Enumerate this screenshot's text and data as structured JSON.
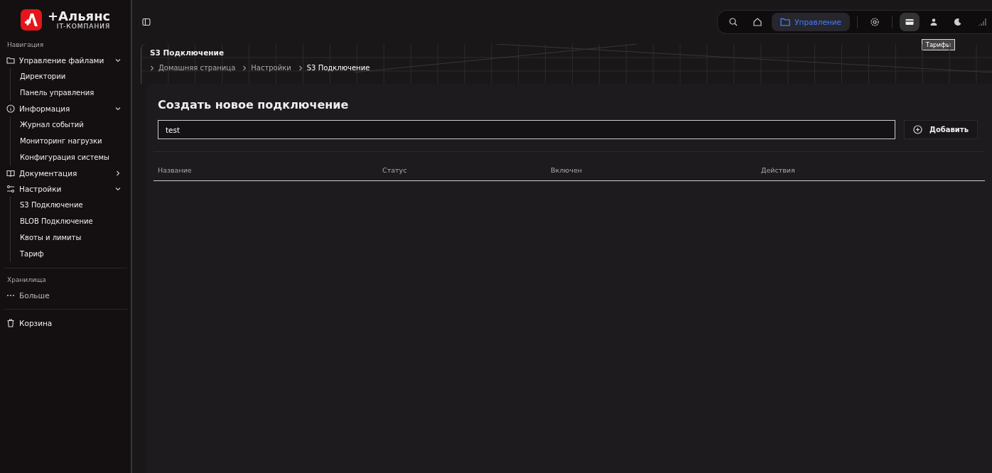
{
  "logo": {
    "name": "+Альянс",
    "subtitle": "IT-КОМПАНИЯ"
  },
  "sidebar": {
    "section": "Навигация",
    "items": [
      {
        "label": "Управление файлами",
        "kind": "folder",
        "expanded": true,
        "children": [
          {
            "label": "Директории"
          },
          {
            "label": "Панель управления"
          }
        ]
      },
      {
        "label": "Информация",
        "kind": "info",
        "expanded": true,
        "children": [
          {
            "label": "Журнал событий"
          },
          {
            "label": "Мониторинг нагрузки"
          },
          {
            "label": "Конфигурация системы"
          }
        ]
      },
      {
        "label": "Документация",
        "kind": "book",
        "expanded": false
      },
      {
        "label": "Настройки",
        "kind": "sliders",
        "expanded": true,
        "children": [
          {
            "label": "S3 Подключение"
          },
          {
            "label": "BLOB Подключение"
          },
          {
            "label": "Квоты и лимиты"
          },
          {
            "label": "Тариф"
          }
        ]
      }
    ],
    "storage_section": "Хранилища",
    "more": "Больше",
    "trash": "Корзина"
  },
  "toolbar": [
    {
      "kind": "search",
      "selected": false
    },
    {
      "kind": "home",
      "selected": false
    },
    {
      "kind": "folder",
      "label": "Управление",
      "selected": true
    },
    {
      "kind": "divider"
    },
    {
      "kind": "gear",
      "selected": false
    },
    {
      "kind": "divider"
    },
    {
      "kind": "card",
      "selected": true
    },
    {
      "kind": "user",
      "selected": false
    },
    {
      "kind": "moon",
      "selected": false
    },
    {
      "kind": "signal",
      "selected": false
    }
  ],
  "tooltip": "Тарифы",
  "page": {
    "title": "S3 Подключение",
    "breadcrumbs": [
      "Домашняя страница",
      "Настройки",
      "S3 Подключение"
    ]
  },
  "card": {
    "title": "Создать новое подключение",
    "input_value": "test",
    "add_button": "Добавить",
    "columns": [
      "Название",
      "Статус",
      "Включен",
      "Действия"
    ]
  }
}
